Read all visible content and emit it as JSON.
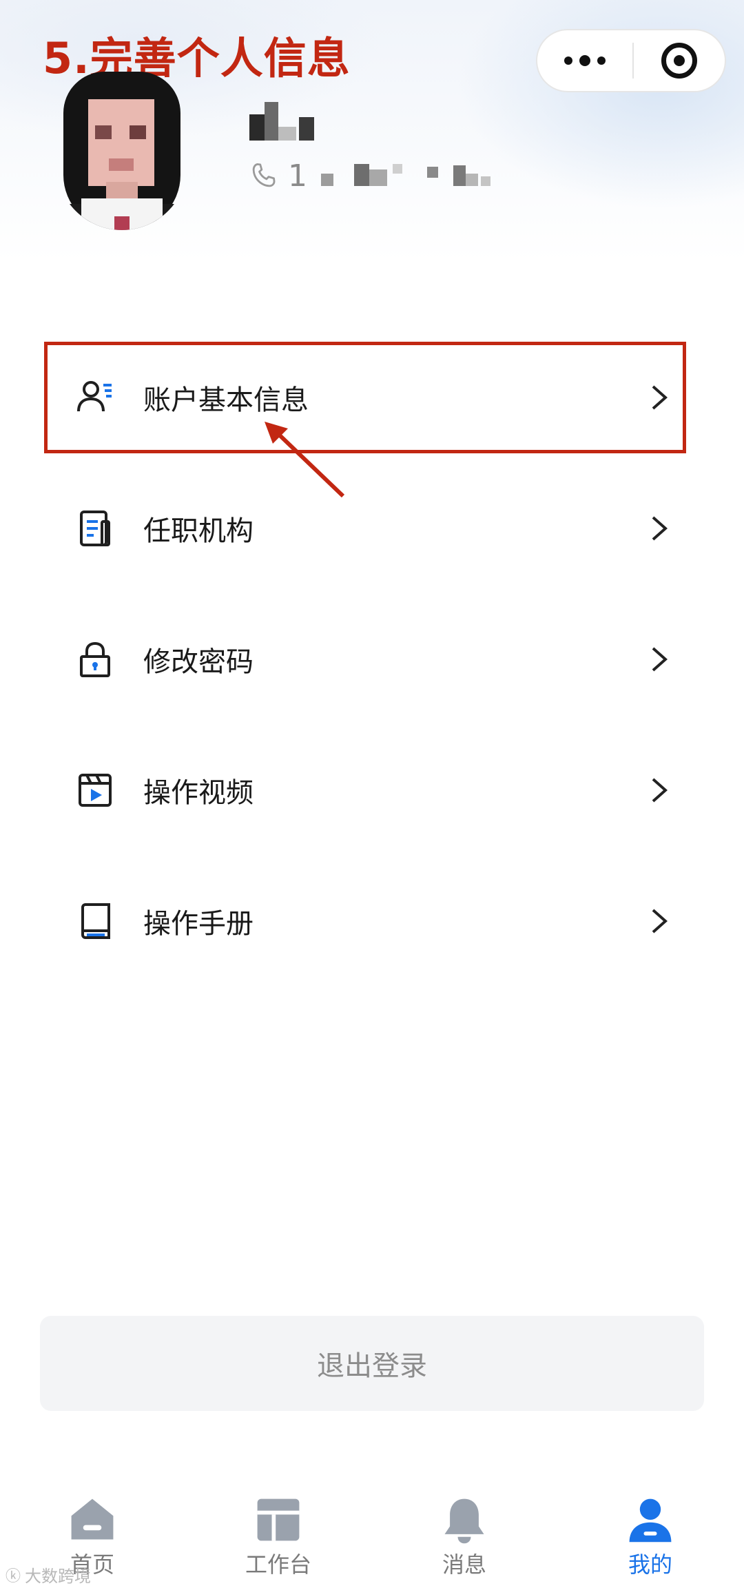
{
  "annotation": {
    "title": "5.完善个人信息",
    "color": "#c22712"
  },
  "capsule": {
    "more_icon": "more-dots-icon",
    "close_icon": "target-close-icon"
  },
  "profile": {
    "avatar": "avatar-photo",
    "username": "",
    "phone_prefix": "1"
  },
  "menu": {
    "items": [
      {
        "label": "账户基本信息",
        "icon": "user-list-icon",
        "highlighted": true
      },
      {
        "label": "任职机构",
        "icon": "document-icon"
      },
      {
        "label": "修改密码",
        "icon": "lock-icon"
      },
      {
        "label": "操作视频",
        "icon": "video-icon"
      },
      {
        "label": "操作手册",
        "icon": "book-icon"
      }
    ]
  },
  "logout": {
    "label": "退出登录"
  },
  "tabbar": {
    "items": [
      {
        "label": "首页",
        "icon": "home-icon"
      },
      {
        "label": "工作台",
        "icon": "workbench-icon"
      },
      {
        "label": "消息",
        "icon": "bell-icon"
      },
      {
        "label": "我的",
        "icon": "user-icon",
        "active": true
      }
    ],
    "active_color": "#1a73e8",
    "inactive_color": "#7a7a7a"
  },
  "watermark": {
    "text": "大数跨境"
  }
}
